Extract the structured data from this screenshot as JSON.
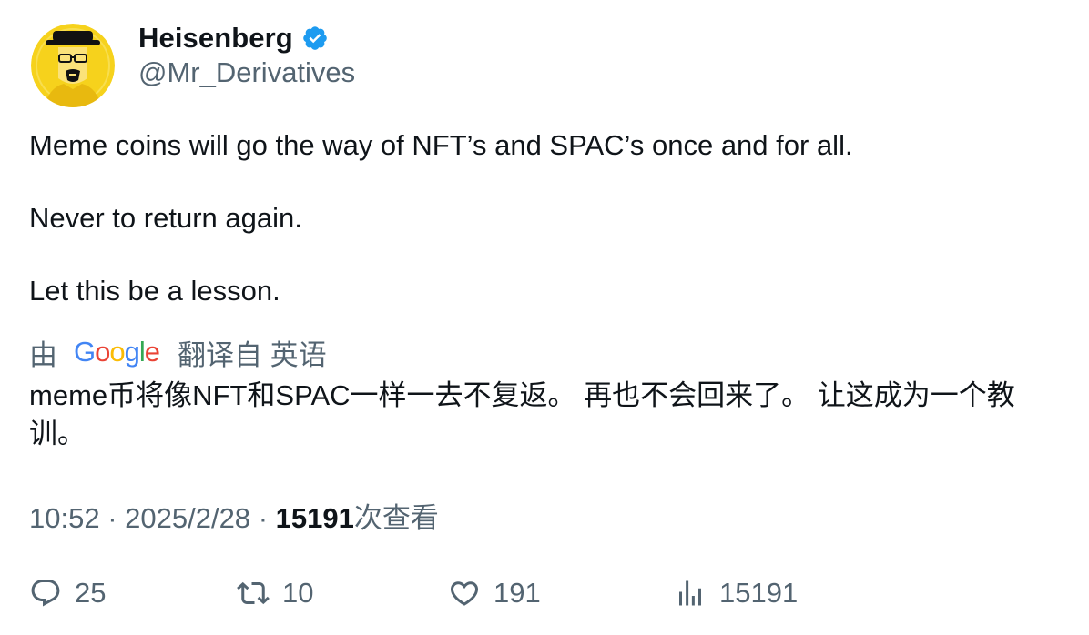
{
  "author": {
    "display_name": "Heisenberg",
    "handle": "@Mr_Derivatives",
    "verified": true,
    "avatar_icon": "heisenberg-avatar"
  },
  "tweet": {
    "lines": [
      "Meme coins will go the way of NFT’s and SPAC’s once and for all.",
      "Never to return again.",
      "Let this be a lesson."
    ]
  },
  "translation": {
    "prefix": "由",
    "provider": "Google",
    "suffix": "翻译自 英语",
    "text": "meme币将像NFT和SPAC一样一去不复返。 再也不会回来了。 让这成为一个教训。"
  },
  "meta": {
    "time": "10:52",
    "separator": "·",
    "date": "2025/2/28",
    "views_count": "15191",
    "views_label": "次查看"
  },
  "actions": {
    "reply_count": "25",
    "retweet_count": "10",
    "like_count": "191",
    "views_count": "15191"
  },
  "colors": {
    "text_primary": "#0f1419",
    "text_secondary": "#536471",
    "verified_blue": "#1d9bf0"
  }
}
